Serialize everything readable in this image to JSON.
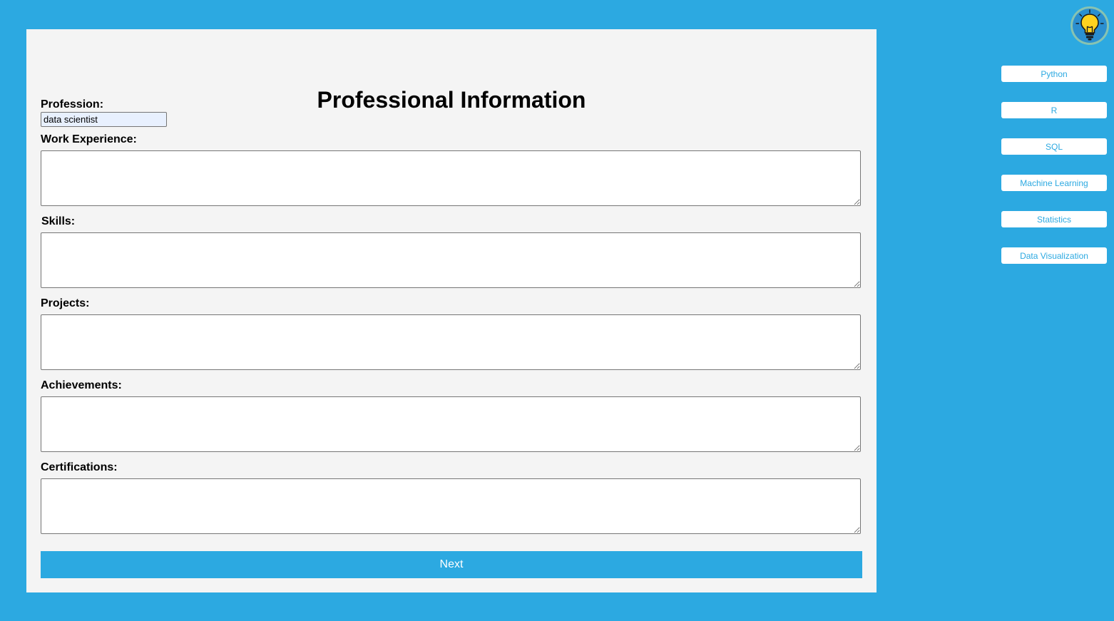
{
  "form": {
    "title": "Professional Information",
    "profession_label": "Profession:",
    "profession_value": "data scientist",
    "work_experience_label": "Work Experience:",
    "skills_label": "Skills:",
    "projects_label": "Projects:",
    "achievements_label": "Achievements:",
    "certifications_label": "Certifications:",
    "next_label": "Next"
  },
  "sidebar": {
    "icon": "lightbulb-icon",
    "skills": [
      "Python",
      "R",
      "SQL",
      "Machine Learning",
      "Statistics",
      "Data Visualization"
    ]
  },
  "colors": {
    "background": "#2ca9e1",
    "panel": "#f4f4f4",
    "accent": "#2ca9e1"
  }
}
